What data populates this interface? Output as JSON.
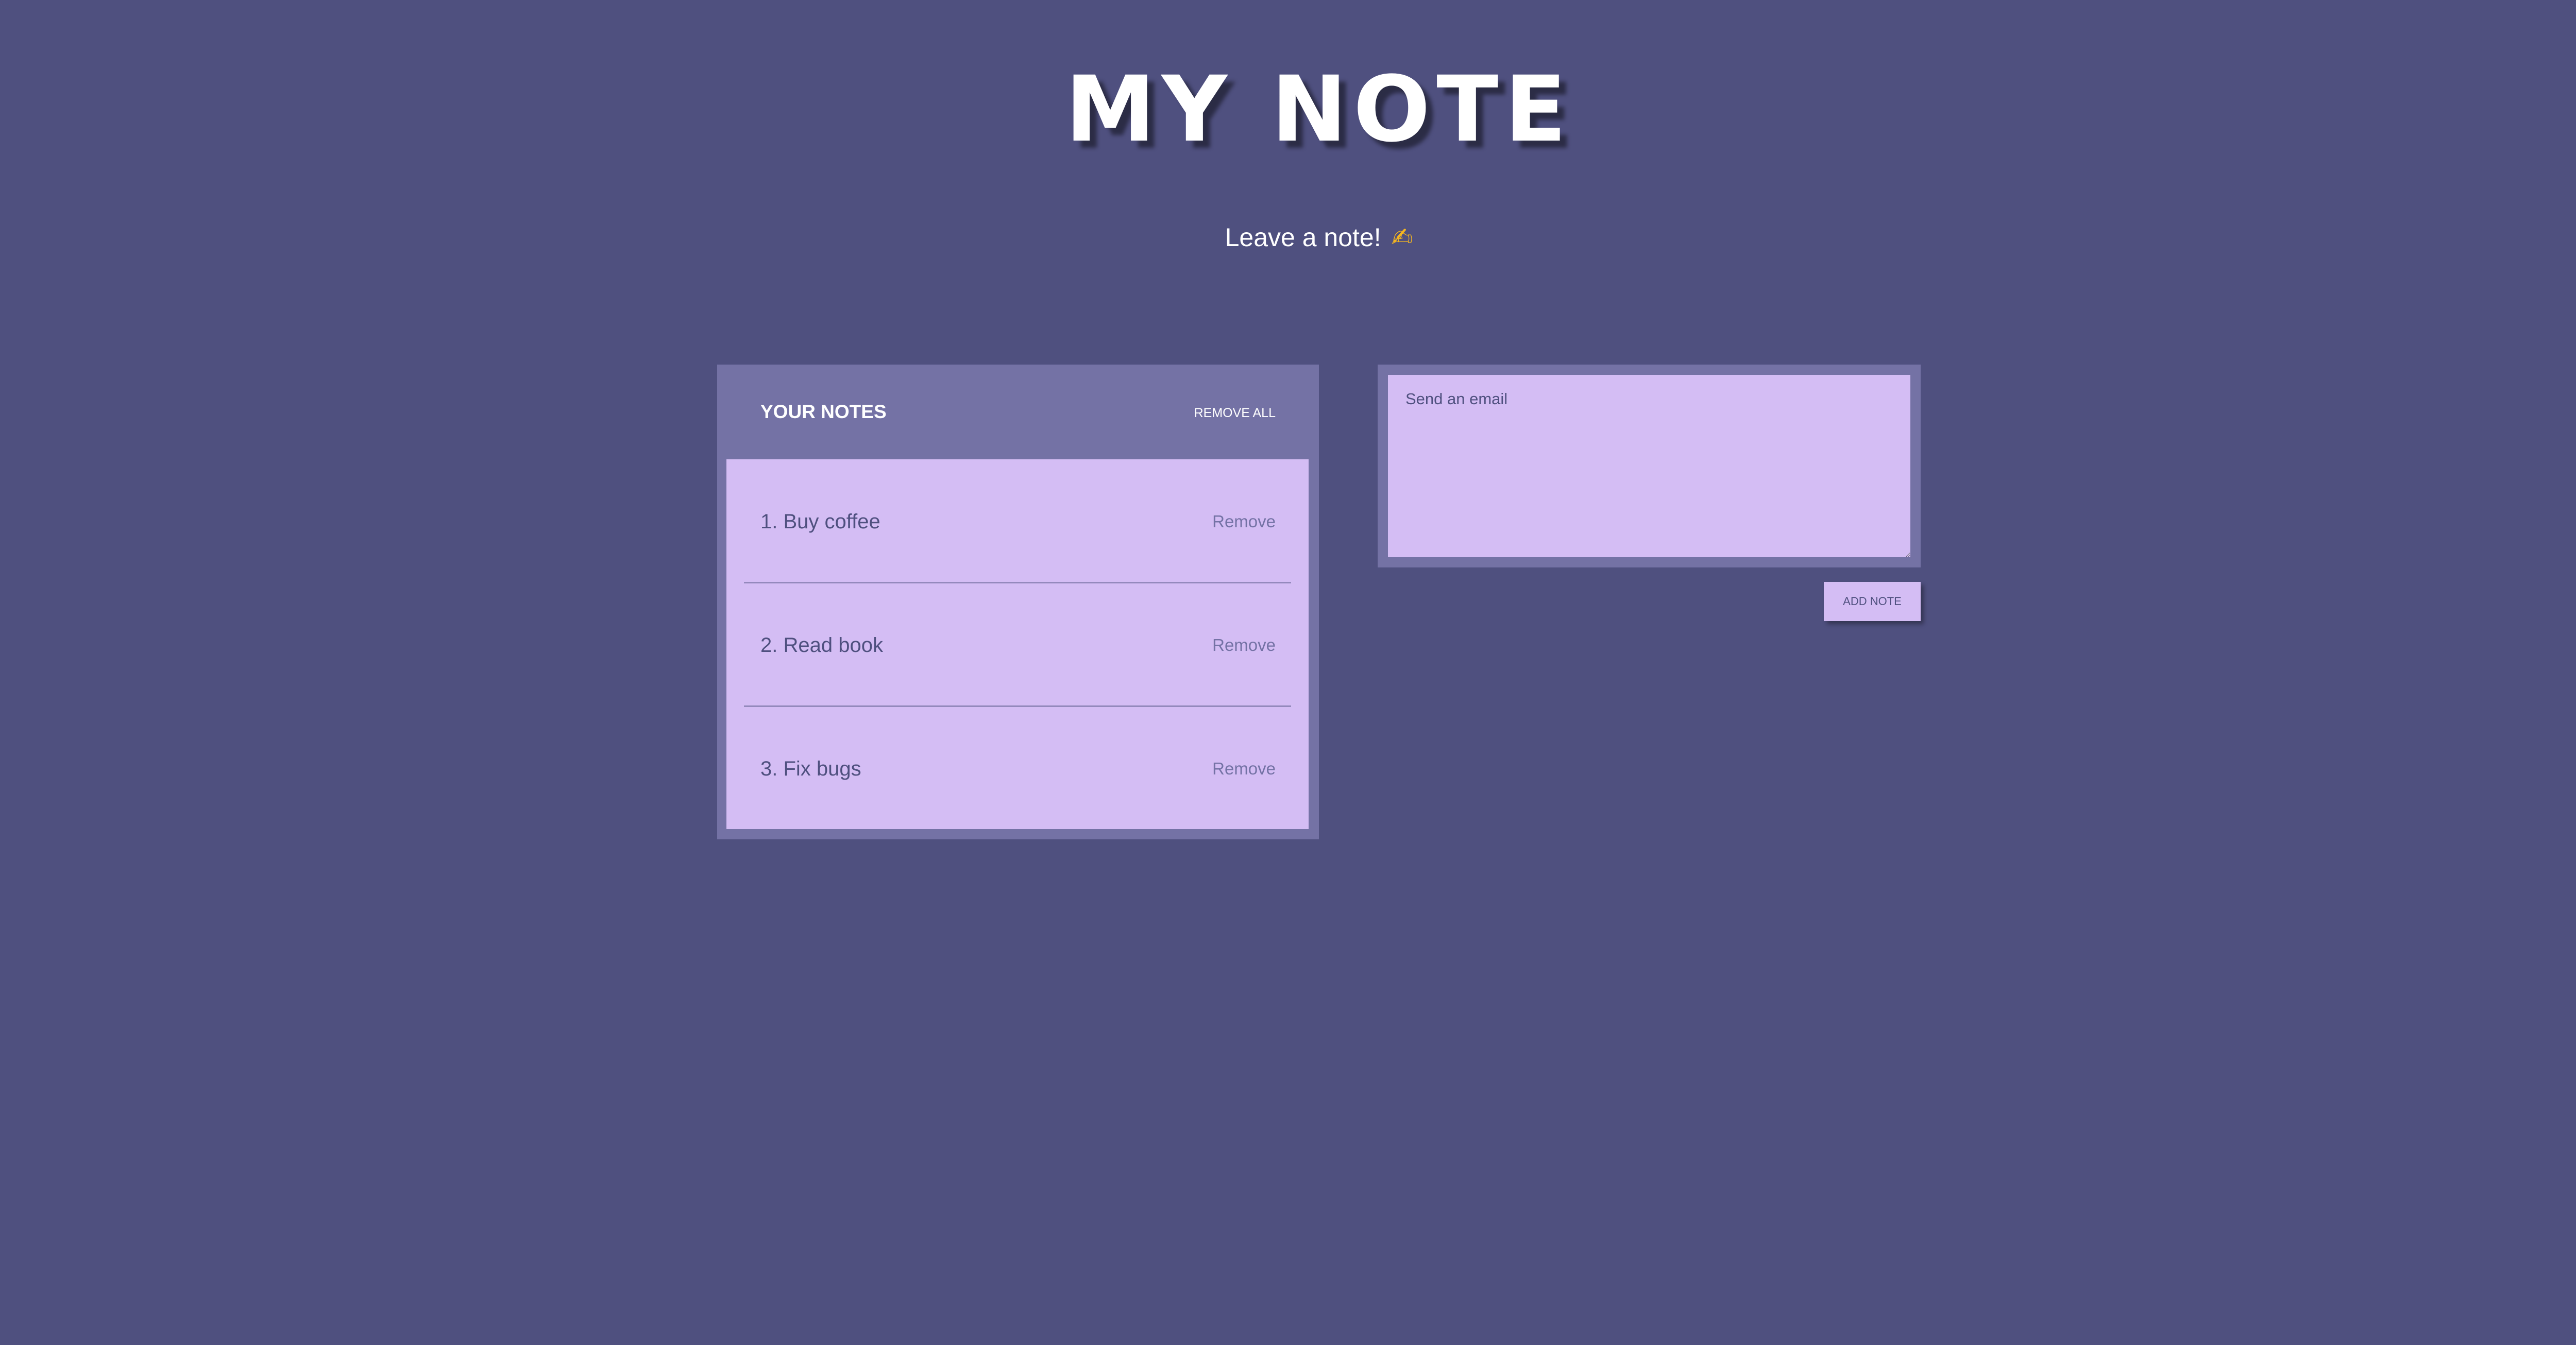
{
  "header": {
    "title": "MY NOTE",
    "subtitle": "Leave a note!",
    "subtitle_emoji": "✍"
  },
  "notes_panel": {
    "heading": "YOUR NOTES",
    "remove_all_label": "REMOVE ALL",
    "items": [
      {
        "text": "1. Buy coffee",
        "remove_label": "Remove"
      },
      {
        "text": "2. Read book",
        "remove_label": "Remove"
      },
      {
        "text": "3. Fix bugs",
        "remove_label": "Remove"
      }
    ]
  },
  "composer": {
    "input_value": "Send an email",
    "add_button_label": "ADD NOTE"
  },
  "colors": {
    "background": "#4f507f",
    "panel": "#7472a5",
    "card": "#d4bdf4",
    "title_text": "#ffffff"
  },
  "icons": {
    "subtitle_icon": "writing-hand-icon"
  }
}
